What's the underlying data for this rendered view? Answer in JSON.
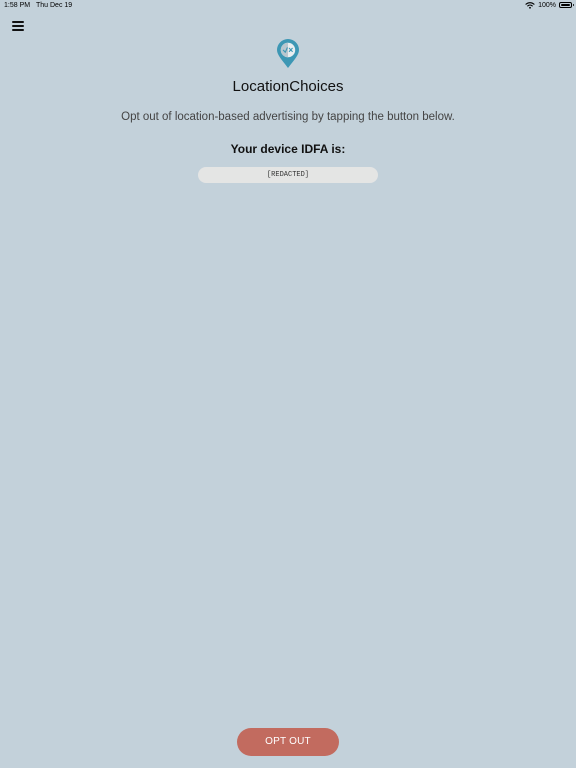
{
  "status_bar": {
    "time": "1:58 PM",
    "date": "Thu Dec 19",
    "battery": "100%",
    "battery_level": 1.0,
    "icons": [
      "wifi-icon",
      "battery-icon"
    ]
  },
  "header": {
    "menu_icon": "hamburger-menu-icon",
    "logo_icon": "location-pin-check-cross-icon"
  },
  "main": {
    "title": "LocationChoices",
    "description": "Opt out of location-based advertising by tapping the button below.",
    "idfa_label": "Your device IDFA is:",
    "idfa_value": "[REDACTED]"
  },
  "footer": {
    "opt_out_label": "OPT OUT"
  },
  "colors": {
    "background": "#c3d1da",
    "accent_button": "#c26b5f",
    "logo_blue": "#3d97b4",
    "field_background": "#e4e5e4"
  }
}
